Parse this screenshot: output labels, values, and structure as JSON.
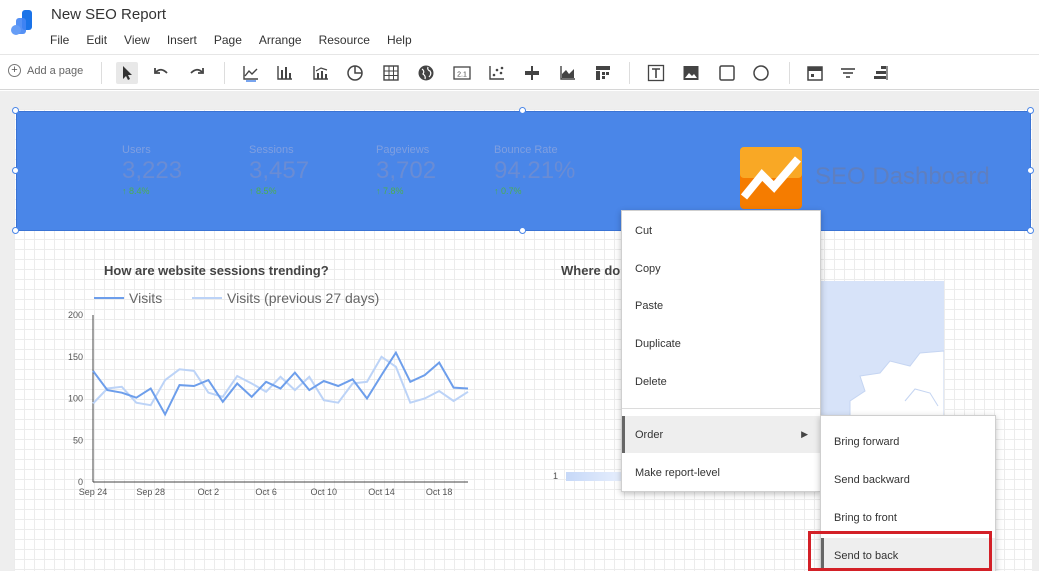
{
  "app": {
    "doc_title": "New SEO Report",
    "menu": [
      "File",
      "Edit",
      "View",
      "Insert",
      "Page",
      "Arrange",
      "Resource",
      "Help"
    ]
  },
  "toolbar": {
    "add_page_label": "Add a page",
    "icons": [
      "select-pointer-icon",
      "undo-icon",
      "redo-icon",
      "time-series-icon",
      "bar-chart-icon",
      "combo-chart-icon",
      "pie-chart-icon",
      "table-icon",
      "geo-map-icon",
      "scorecard-icon",
      "scatter-chart-icon",
      "bullet-chart-icon",
      "area-chart-icon",
      "pivot-table-icon",
      "text-icon",
      "image-icon",
      "rectangle-icon",
      "circle-icon",
      "date-range-icon",
      "filter-control-icon",
      "data-control-icon"
    ],
    "scorecard_text": "2.1"
  },
  "banner": {
    "kpis": [
      {
        "label": "Users",
        "value": "3,223",
        "change": "↑ 8.4%"
      },
      {
        "label": "Sessions",
        "value": "3,457",
        "change": "↑ 8.5%"
      },
      {
        "label": "Pageviews",
        "value": "3,702",
        "change": "↑ 7.8%"
      },
      {
        "label": "Bounce Rate",
        "value": "94.21%",
        "change": "↑ 0.7%"
      }
    ],
    "title": "SEO Dashboard",
    "colors": {
      "banner": "#4a86e8",
      "logo_orange": "#f57c00"
    }
  },
  "sessions_chart": {
    "title": "How are website sessions trending?"
  },
  "map": {
    "title_visible": "Where do",
    "legend_min": "1"
  },
  "context_menu": {
    "items": [
      "Cut",
      "Copy",
      "Paste",
      "Duplicate",
      "Delete",
      "Order",
      "Make report-level"
    ],
    "hovered": "Order",
    "submenu": [
      "Bring forward",
      "Send backward",
      "Bring to front",
      "Send to back"
    ],
    "submenu_hovered": "Send to back",
    "highlight_color": "#d32027"
  },
  "chart_data": {
    "type": "line",
    "title": "How are website sessions trending?",
    "x": [
      "Sep 24",
      "Sep 25",
      "Sep 26",
      "Sep 27",
      "Sep 28",
      "Sep 29",
      "Sep 30",
      "Oct 1",
      "Oct 2",
      "Oct 3",
      "Oct 4",
      "Oct 5",
      "Oct 6",
      "Oct 7",
      "Oct 8",
      "Oct 9",
      "Oct 10",
      "Oct 11",
      "Oct 12",
      "Oct 13",
      "Oct 14",
      "Oct 15",
      "Oct 16",
      "Oct 17",
      "Oct 18",
      "Oct 19",
      "Oct 20"
    ],
    "x_tick_labels": [
      "Sep 24",
      "Sep 28",
      "Oct 2",
      "Oct 6",
      "Oct 10",
      "Oct 14",
      "Oct 18"
    ],
    "series": [
      {
        "name": "Visits",
        "color": "#6d9eeb",
        "values": [
          133,
          110,
          107,
          101,
          112,
          81,
          116,
          115,
          122,
          96,
          118,
          102,
          120,
          112,
          131,
          110,
          121,
          115,
          123,
          100,
          128,
          155,
          120,
          128,
          143,
          113,
          112
        ]
      },
      {
        "name": "Visits (previous 27 days)",
        "color": "#bcd3f7",
        "values": [
          94,
          112,
          114,
          95,
          92,
          122,
          135,
          133,
          107,
          102,
          127,
          118,
          108,
          126,
          110,
          126,
          98,
          95,
          118,
          120,
          150,
          138,
          95,
          100,
          109,
          97,
          108
        ]
      }
    ],
    "ylim": [
      0,
      200
    ],
    "yticks": [
      0,
      50,
      100,
      150,
      200
    ],
    "legend": "top",
    "grid": false
  }
}
